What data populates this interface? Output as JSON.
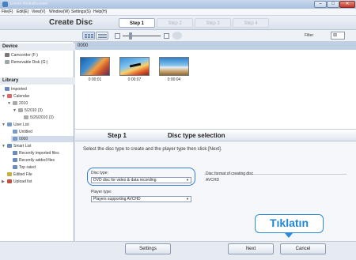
{
  "titlebar": {
    "title": "Everio MediaBrowser",
    "buttons": {
      "minimize": "–",
      "maximize": "□",
      "close": "✕"
    }
  },
  "menubar": {
    "items": [
      "File(F)",
      "Edit(E)",
      "View(V)",
      "Window(W)",
      "Settings(S)",
      "Help(H)"
    ]
  },
  "header": {
    "title": "Create Disc",
    "steps": [
      "Step 1",
      "Step 2",
      "Step 3",
      "Step 4"
    ],
    "active_step": 0
  },
  "toolbar": {
    "filter_label": "Filter",
    "filter_value": "⊠"
  },
  "sidebar": {
    "device_header": "Device",
    "devices": [
      "Camcorder (F:)",
      "Removable Disk (G:)"
    ],
    "library_header": "Library",
    "library_items": [
      "Imported",
      "Calendar",
      "2010",
      "5/2010 (3)",
      "5/26/2010 (3)",
      "User List",
      "Untitled",
      "0000",
      "Smart List",
      "Recently imported files",
      "Recently added files",
      "Top rated",
      "Edited File",
      "Upload list"
    ],
    "selected_item": "0000"
  },
  "content": {
    "folder_name": "0000",
    "thumbnails": [
      {
        "label": "0:00:01"
      },
      {
        "label": "0:00:07"
      },
      {
        "label": "0:00:04"
      }
    ]
  },
  "panel": {
    "step_label": "Step 1",
    "title": "Disc type selection",
    "instruction": "Select the disc type to create and the player type then click [Next].",
    "disc_type_label": "Disc type:",
    "disc_type_value": "DVD disc for video & data recording",
    "player_type_label": "Player type:",
    "player_type_value": "Players supporting AVCHD",
    "format_label": "Disc format of creating disc",
    "format_value": "AVCHD"
  },
  "callout": {
    "text": "Tıklatın"
  },
  "bottombar": {
    "settings": "Settings",
    "next": "Next",
    "cancel": "Cancel"
  },
  "colors": {
    "accent": "#2d8ad8",
    "folder_bar": "#bfcfe4",
    "titlebar": "#a9c0df"
  }
}
